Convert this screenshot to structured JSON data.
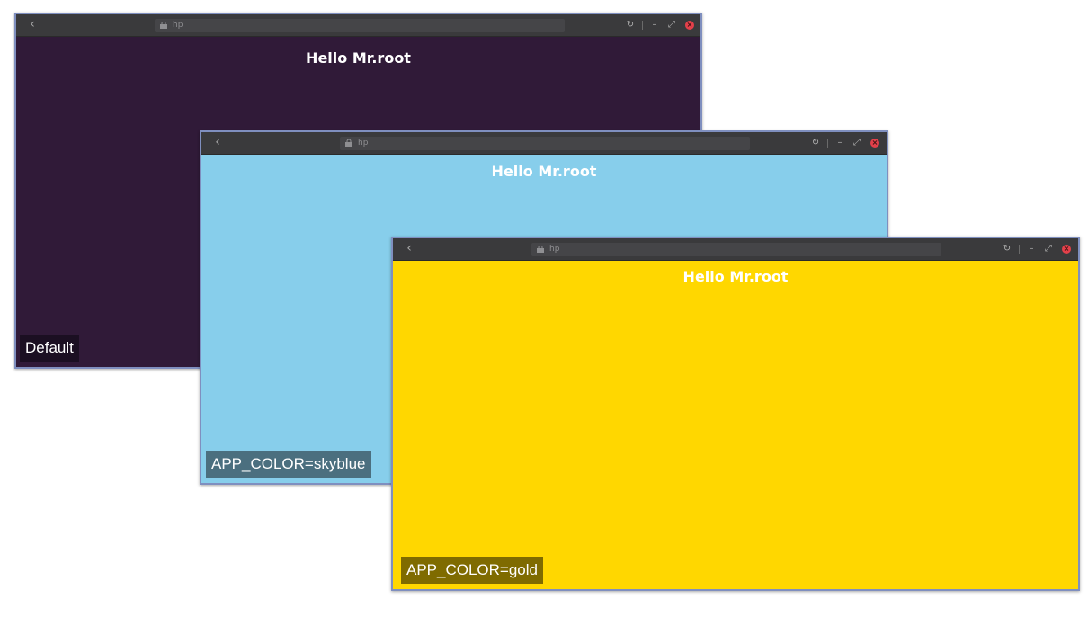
{
  "windows": [
    {
      "id": "default",
      "url": "hp",
      "greeting": "Hello Mr.root",
      "background": "#301a38",
      "label": "Default",
      "label_bg": "#1b0f22"
    },
    {
      "id": "skyblue",
      "url": "hp",
      "greeting": "Hello Mr.root",
      "background": "#87ceeb",
      "label": "APP_COLOR=skyblue",
      "label_bg": "#4b6f7f"
    },
    {
      "id": "gold",
      "url": "hp",
      "greeting": "Hello Mr.root",
      "background": "#ffd700",
      "label": "APP_COLOR=gold",
      "label_bg": "#7f6b00"
    }
  ],
  "titlebar": {
    "back_icon": "chevron-left-icon",
    "lock_icon": "lock-icon",
    "reload_icon": "reload-icon",
    "minimize_icon": "minimize-icon",
    "maximize_icon": "maximize-icon",
    "close_icon": "close-icon",
    "close_color": "#e3404a"
  }
}
